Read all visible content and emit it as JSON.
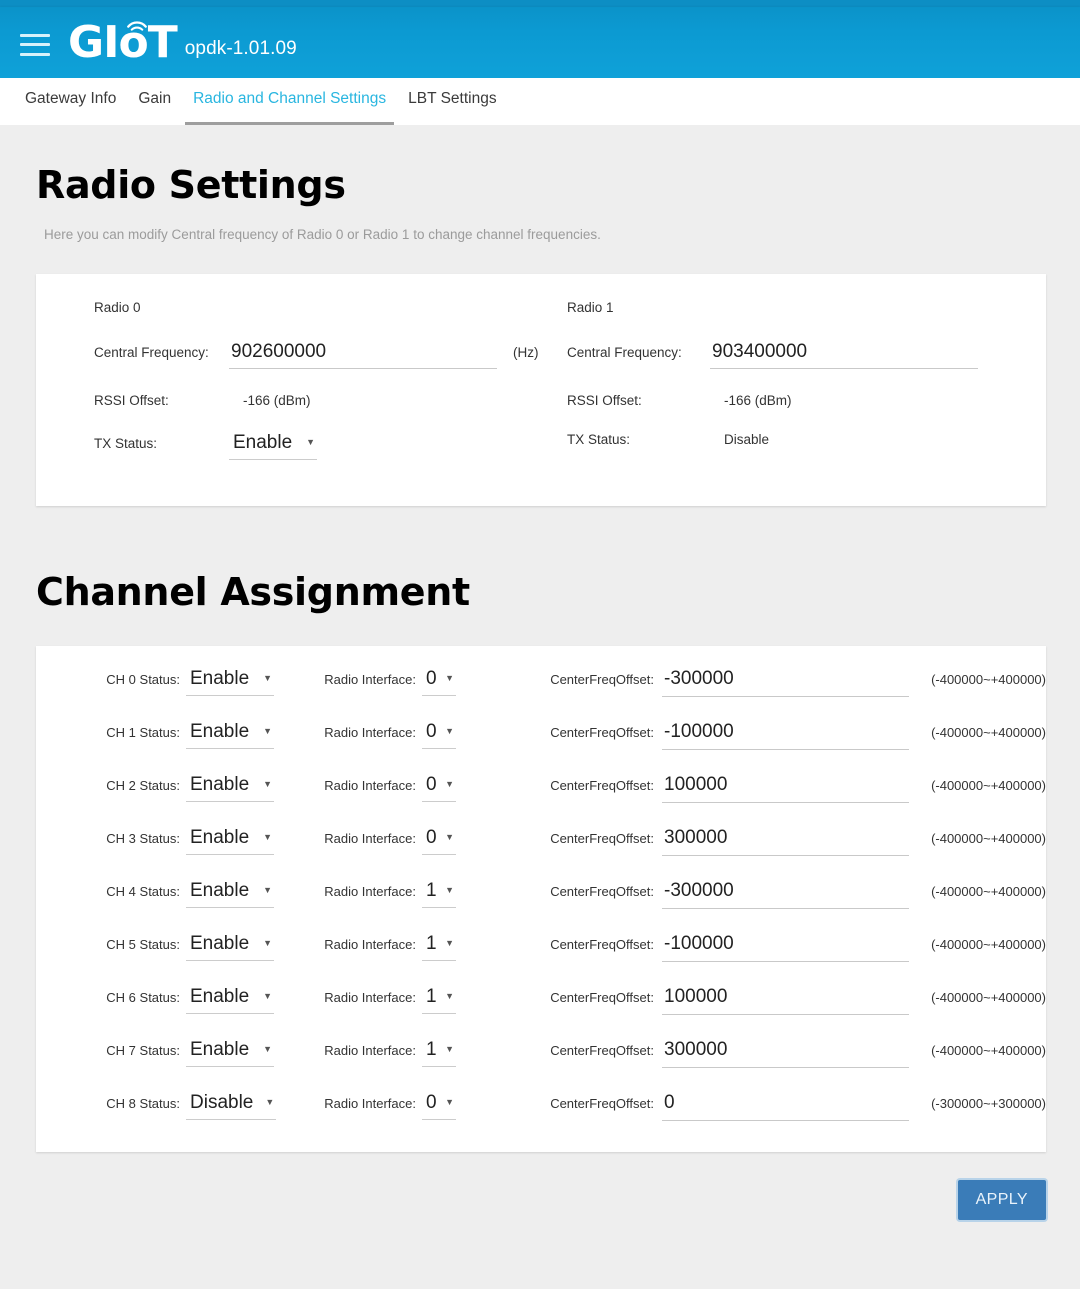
{
  "appbar": {
    "menu_icon": "hamburger-menu-icon",
    "logo_text": "GIoT",
    "logo_wifi_icon": "wifi-arc-icon",
    "version": "opdk-1.01.09",
    "accent_color": "#0e9bd1",
    "topstrip_color": "#0d8ec4"
  },
  "tabs": [
    {
      "label": "Gateway Info",
      "active": false
    },
    {
      "label": "Gain",
      "active": false
    },
    {
      "label": "Radio and Channel Settings",
      "active": true
    },
    {
      "label": "LBT Settings",
      "active": false
    }
  ],
  "tab_active_color": "#29b6e0",
  "radio_section": {
    "title": "Radio Settings",
    "description": "Here you can modify Central frequency of Radio 0 or Radio 1 to change channel frequencies.",
    "radios": [
      {
        "name": "Radio 0",
        "freq_label": "Central Frequency:",
        "freq_value": "902600000",
        "freq_unit": "(Hz)",
        "rssi_label": "RSSI Offset:",
        "rssi_value": "-166 (dBm)",
        "tx_label": "TX Status:",
        "tx_value": "Enable",
        "tx_is_select": true
      },
      {
        "name": "Radio 1",
        "freq_label": "Central Frequency:",
        "freq_value": "903400000",
        "freq_unit": "",
        "rssi_label": "RSSI Offset:",
        "rssi_value": "-166 (dBm)",
        "tx_label": "TX Status:",
        "tx_value": "Disable",
        "tx_is_select": false
      }
    ]
  },
  "channel_section": {
    "title": "Channel Assignment",
    "iface_label": "Radio Interface:",
    "offset_label": "CenterFreqOffset:",
    "rows": [
      {
        "status_label": "CH 0 Status:",
        "status": "Enable",
        "iface": "0",
        "offset": "-300000",
        "range": "(-400000~+400000)"
      },
      {
        "status_label": "CH 1 Status:",
        "status": "Enable",
        "iface": "0",
        "offset": "-100000",
        "range": "(-400000~+400000)"
      },
      {
        "status_label": "CH 2 Status:",
        "status": "Enable",
        "iface": "0",
        "offset": "100000",
        "range": "(-400000~+400000)"
      },
      {
        "status_label": "CH 3 Status:",
        "status": "Enable",
        "iface": "0",
        "offset": "300000",
        "range": "(-400000~+400000)"
      },
      {
        "status_label": "CH 4 Status:",
        "status": "Enable",
        "iface": "1",
        "offset": "-300000",
        "range": "(-400000~+400000)"
      },
      {
        "status_label": "CH 5 Status:",
        "status": "Enable",
        "iface": "1",
        "offset": "-100000",
        "range": "(-400000~+400000)"
      },
      {
        "status_label": "CH 6 Status:",
        "status": "Enable",
        "iface": "1",
        "offset": "100000",
        "range": "(-400000~+400000)"
      },
      {
        "status_label": "CH 7 Status:",
        "status": "Enable",
        "iface": "1",
        "offset": "300000",
        "range": "(-400000~+400000)"
      },
      {
        "status_label": "CH 8 Status:",
        "status": "Disable",
        "iface": "0",
        "offset": "0",
        "range": "(-300000~+300000)"
      }
    ]
  },
  "footer": {
    "apply_label": "APPLY",
    "apply_color": "#3a7cb8"
  }
}
